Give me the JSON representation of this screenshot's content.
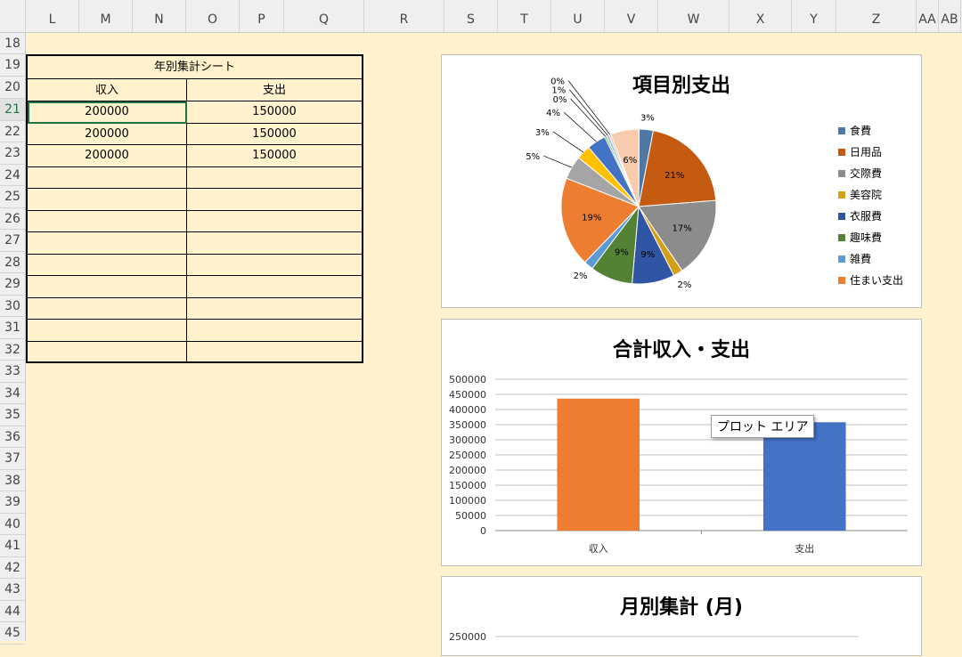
{
  "columns": [
    "L",
    "M",
    "N",
    "O",
    "P",
    "Q",
    "R",
    "S",
    "T",
    "U",
    "V",
    "W",
    "X",
    "Y",
    "Z",
    "AA",
    "AB"
  ],
  "rows": [
    "18",
    "19",
    "20",
    "21",
    "22",
    "23",
    "24",
    "25",
    "26",
    "27",
    "28",
    "29",
    "30",
    "31",
    "32",
    "33",
    "34",
    "35",
    "36",
    "37",
    "38",
    "39",
    "40",
    "41",
    "42",
    "43",
    "44",
    "45"
  ],
  "selected_row": "21",
  "table": {
    "title": "年別集計シート",
    "headers": [
      "収入",
      "支出"
    ],
    "rows": [
      [
        "200000",
        "150000"
      ],
      [
        "200000",
        "150000"
      ],
      [
        "200000",
        "150000"
      ]
    ]
  },
  "tooltip": "プロット エリア",
  "chart_data": [
    {
      "type": "pie",
      "title": "項目別支出",
      "slices": [
        {
          "name": "食費",
          "value": 3,
          "label": "3%",
          "color": "#4e79a7"
        },
        {
          "name": "日用品",
          "value": 21,
          "label": "21%",
          "color": "#c55a11"
        },
        {
          "name": "交際費",
          "value": 17,
          "label": "17%",
          "color": "#8c8c8c"
        },
        {
          "name": "美容院",
          "value": 2,
          "label": "2%",
          "color": "#d4a017"
        },
        {
          "name": "衣服費",
          "value": 9,
          "label": "9%",
          "color": "#2f55a4"
        },
        {
          "name": "趣味費",
          "value": 9,
          "label": "9%",
          "color": "#548235"
        },
        {
          "name": "雑費",
          "value": 2,
          "label": "2%",
          "color": "#5b9bd5"
        },
        {
          "name": "住まい支出",
          "value": 19,
          "label": "19%",
          "color": "#ed7d31"
        },
        {
          "name": "",
          "value": 5,
          "label": "5%",
          "color": "#a5a5a5"
        },
        {
          "name": "",
          "value": 3,
          "label": "3%",
          "color": "#ffc000"
        },
        {
          "name": "",
          "value": 4,
          "label": "4%",
          "color": "#4472c4"
        },
        {
          "name": "",
          "value": 0.4,
          "label": "0%",
          "color": "#70ad47"
        },
        {
          "name": "",
          "value": 0.6,
          "label": "1%",
          "color": "#9dc3e6"
        },
        {
          "name": "",
          "value": 0.4,
          "label": "0%",
          "color": "#f4b183"
        },
        {
          "name": "",
          "value": 6,
          "label": "6%",
          "color": "#f8cbad"
        }
      ],
      "legend": [
        "食費",
        "日用品",
        "交際費",
        "美容院",
        "衣服費",
        "趣味費",
        "雑費",
        "住まい支出"
      ],
      "legend_colors": [
        "#4e79a7",
        "#c55a11",
        "#8c8c8c",
        "#d4a017",
        "#2f55a4",
        "#548235",
        "#5b9bd5",
        "#ed7d31"
      ]
    },
    {
      "type": "bar",
      "title": "合計収入・支出",
      "categories": [
        "収入",
        "支出"
      ],
      "values": [
        436000,
        358000
      ],
      "colors": [
        "#ed7d31",
        "#4472c4"
      ],
      "ylim": [
        0,
        500000
      ],
      "yticks": [
        "0",
        "50000",
        "100000",
        "150000",
        "200000",
        "250000",
        "300000",
        "350000",
        "400000",
        "450000",
        "500000"
      ],
      "grid": true
    },
    {
      "type": "bar",
      "title": "月別集計 (月)",
      "yticks_visible": [
        "250000"
      ]
    }
  ]
}
